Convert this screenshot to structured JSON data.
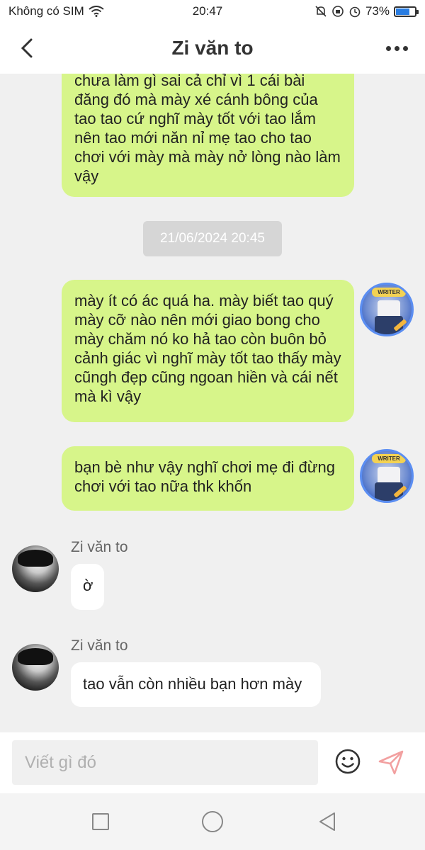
{
  "status_bar": {
    "carrier": "Không có SIM",
    "time": "20:47",
    "battery": "73%",
    "battery_level": 0.73
  },
  "header": {
    "title": "Zi văn to"
  },
  "messages": [
    {
      "direction": "outgoing",
      "text": "chưa làm gì sai cả chỉ vì 1 cái bài đăng đó mà mày xé cánh bông của tao tao cứ nghĩ mày tốt với tao lắm nên tao mới năn nỉ mẹ tao cho tao chơi với mày mà mày nở lòng nào làm vậy"
    },
    {
      "direction": "timestamp",
      "text": "21/06/2024 20:45"
    },
    {
      "direction": "outgoing",
      "text": " mày ít có ác quá ha. mày biết tao quý mày cỡ nào nên mới giao bong cho mày chăm nó ko hả tao còn buôn bỏ cảnh giác vì nghĩ mày tốt tao thấy mày cũngh đẹp cũng ngoan hiền và cái nết mà kì vậy"
    },
    {
      "direction": "outgoing",
      "text": "bạn bè như vậy nghĩ chơi mẹ đi đừng chơi với tao nữa thk khốn"
    },
    {
      "direction": "incoming",
      "sender": "Zi văn to",
      "text": "ờ"
    },
    {
      "direction": "incoming",
      "sender": "Zi văn to",
      "text": "tao vẫn còn nhiều bạn hơn mày"
    }
  ],
  "input": {
    "placeholder": "Viết gì đó"
  },
  "icons": {
    "back": "chevron-left-icon",
    "more": "more-dots-icon",
    "emoji": "smiley-icon",
    "send": "send-icon",
    "nav_recent": "square-icon",
    "nav_home": "circle-icon",
    "nav_back": "triangle-back-icon"
  },
  "colors": {
    "outgoing_bubble": "#d7f58a",
    "incoming_bubble": "#ffffff",
    "chat_background": "#f0f0f0",
    "send_icon": "#f2a0a0"
  }
}
